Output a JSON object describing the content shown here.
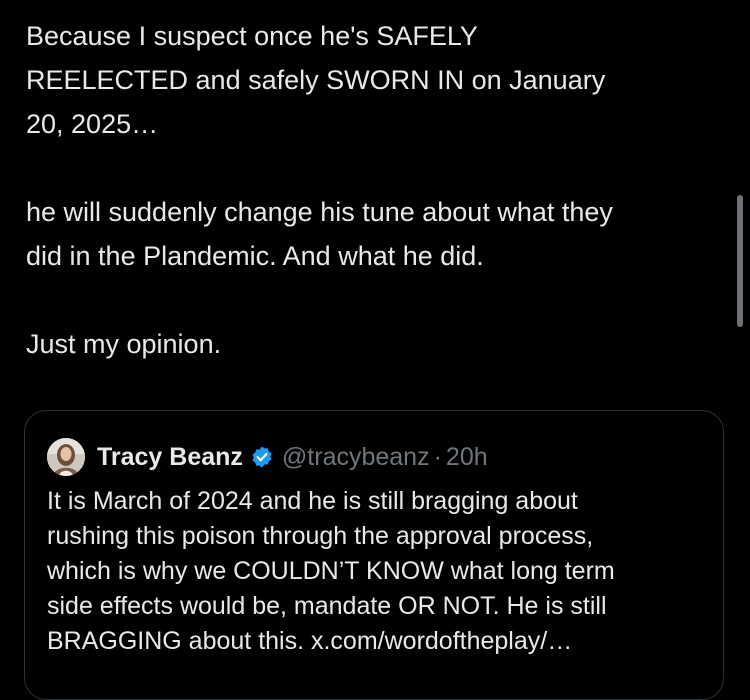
{
  "tweet": {
    "lines": [
      "Because I suspect once he's SAFELY",
      "REELECTED and safely SWORN IN on January",
      "20, 2025…",
      "he will suddenly change his tune about what they",
      "did in the Plandemic.  And what he did.",
      "Just my opinion."
    ]
  },
  "quote": {
    "author_name": "Tracy Beanz",
    "handle": "@tracybeanz",
    "separator": "·",
    "time": "20h",
    "avatar_icon": "profile-photo",
    "verified_icon": "verified-badge-icon",
    "verified_color": "#1d9bf0",
    "lines": [
      "It is March of 2024 and he is still bragging about",
      "rushing this poison through the approval process,",
      "which is why we COULDN’T KNOW what long term",
      "side effects would be, mandate OR NOT. He is still",
      "BRAGGING about this. x.com/wordoftheplay/…"
    ]
  },
  "colors": {
    "background": "#000000",
    "text_primary": "#e7e9ea",
    "text_secondary": "#71767b",
    "border": "#2f3336"
  }
}
